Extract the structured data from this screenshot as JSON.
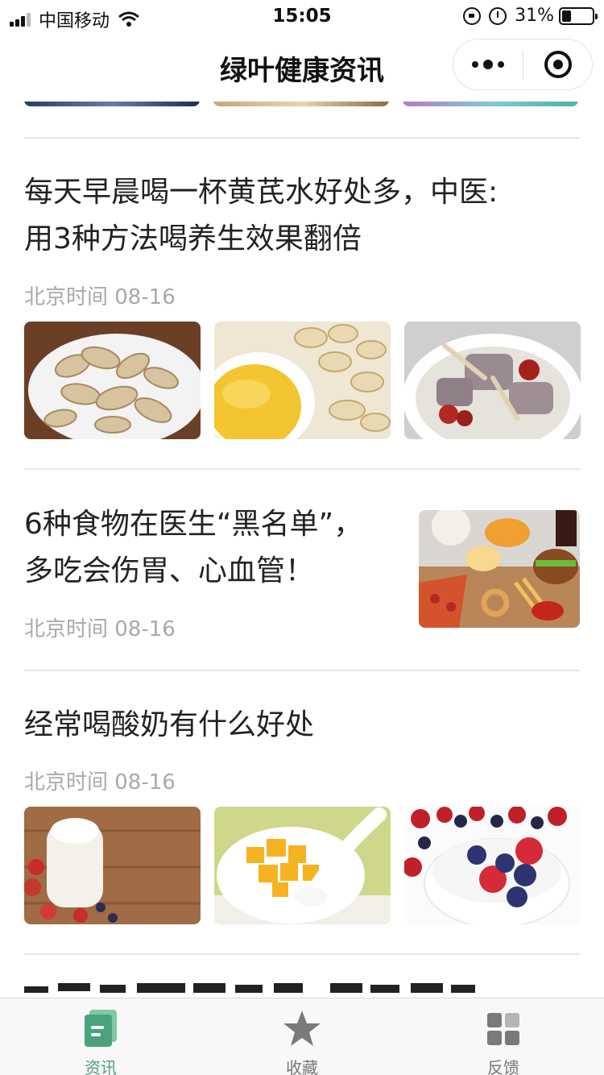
{
  "status_bar": {
    "carrier": "中国移动",
    "time": "15:05",
    "battery_percent": "31%",
    "battery_level": 0.31
  },
  "nav": {
    "title": "绿叶健康资讯",
    "more_icon": "more-dots-icon",
    "close_icon": "close-circle-icon"
  },
  "articles": [
    {
      "title_lines": [
        "每天早晨喝一杯黄芪水好处多，中医:",
        "用3种方法喝养生效果翻倍"
      ],
      "meta": "北京时间 08-16",
      "thumbs": [
        "sliced-herb-image",
        "herbal-tea-image",
        "herbal-soup-image"
      ]
    },
    {
      "title_lines": [
        "6种食物在医生“黑名单”，",
        "多吃会伤胃、心血管！"
      ],
      "meta": "北京时间 08-16",
      "thumbs": [
        "junk-food-image"
      ]
    },
    {
      "title_lines": [
        "经常喝酸奶有什么好处"
      ],
      "meta": "北京时间 08-16",
      "thumbs": [
        "yogurt-bottle-image",
        "yogurt-mango-image",
        "yogurt-berries-image"
      ]
    }
  ],
  "tabs": [
    {
      "label": "资讯",
      "icon": "news-doc-icon",
      "active": true
    },
    {
      "label": "收藏",
      "icon": "star-icon",
      "active": false
    },
    {
      "label": "反馈",
      "icon": "grid-icon",
      "active": false
    }
  ],
  "colors": {
    "accent": "#4aa27b",
    "meta_text": "#a9a9a9",
    "tab_inactive": "#777777"
  }
}
